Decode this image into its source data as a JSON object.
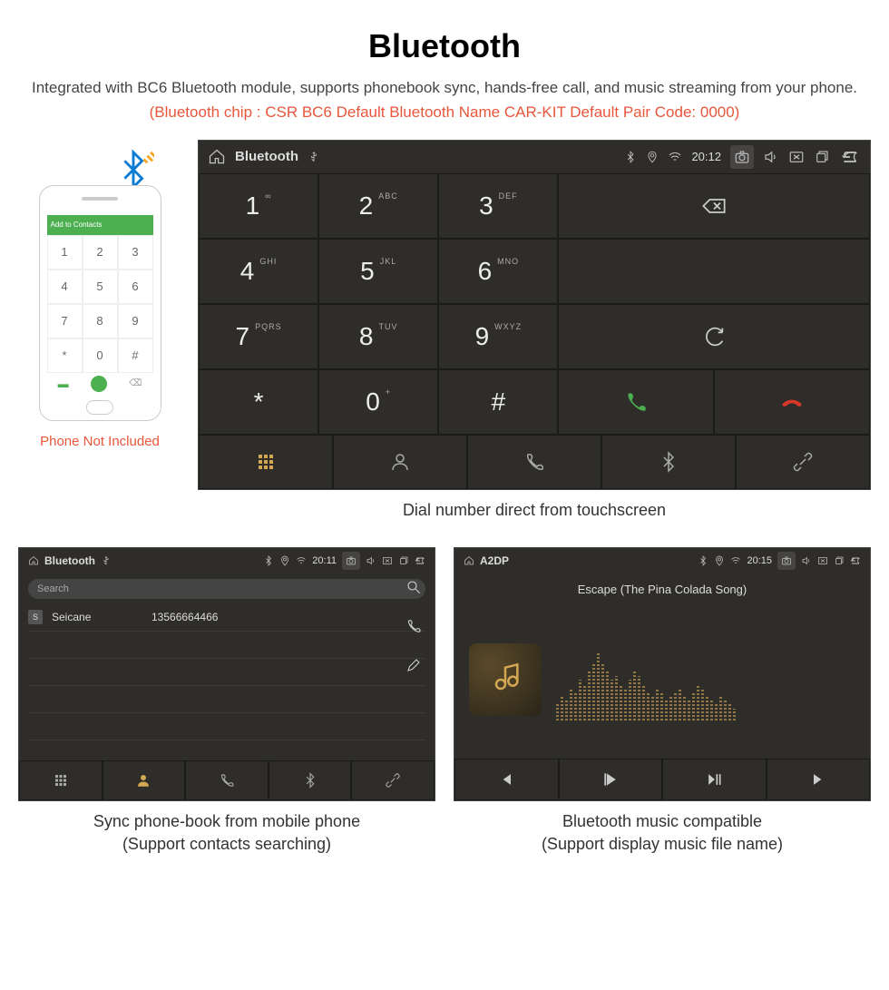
{
  "header": {
    "title": "Bluetooth",
    "description": "Integrated with BC6 Bluetooth module, supports phonebook sync, hands-free call, and music streaming from your phone.",
    "specs": "(Bluetooth chip : CSR BC6    Default Bluetooth Name CAR-KIT    Default Pair Code: 0000)"
  },
  "phone": {
    "top_label": "Add to Contacts",
    "caption": "Phone Not Included",
    "keys": [
      "1",
      "2",
      "3",
      "4",
      "5",
      "6",
      "7",
      "8",
      "9",
      "*",
      "0",
      "#"
    ]
  },
  "main": {
    "status": {
      "title": "Bluetooth",
      "time": "20:12"
    },
    "keypad": [
      {
        "num": "1",
        "sub": "∞"
      },
      {
        "num": "2",
        "sub": "ABC"
      },
      {
        "num": "3",
        "sub": "DEF"
      },
      {
        "num": "4",
        "sub": "GHI"
      },
      {
        "num": "5",
        "sub": "JKL"
      },
      {
        "num": "6",
        "sub": "MNO"
      },
      {
        "num": "7",
        "sub": "PQRS"
      },
      {
        "num": "8",
        "sub": "TUV"
      },
      {
        "num": "9",
        "sub": "WXYZ"
      },
      {
        "num": "*",
        "sub": ""
      },
      {
        "num": "0",
        "sub": "+"
      },
      {
        "num": "#",
        "sub": ""
      }
    ],
    "caption": "Dial number direct from touchscreen"
  },
  "phonebook": {
    "status": {
      "title": "Bluetooth",
      "time": "20:11"
    },
    "search_placeholder": "Search",
    "contact": {
      "badge": "S",
      "name": "Seicane",
      "number": "13566664466"
    },
    "caption_line1": "Sync phone-book from mobile phone",
    "caption_line2": "(Support contacts searching)"
  },
  "a2dp": {
    "status": {
      "title": "A2DP",
      "time": "20:15"
    },
    "track": "Escape (The Pina Colada Song)",
    "caption_line1": "Bluetooth music compatible",
    "caption_line2": "(Support display music file name)"
  },
  "colors": {
    "accent": "#e8563b",
    "gold": "#d4a853",
    "green": "#4caf50",
    "red": "#d9372a"
  }
}
